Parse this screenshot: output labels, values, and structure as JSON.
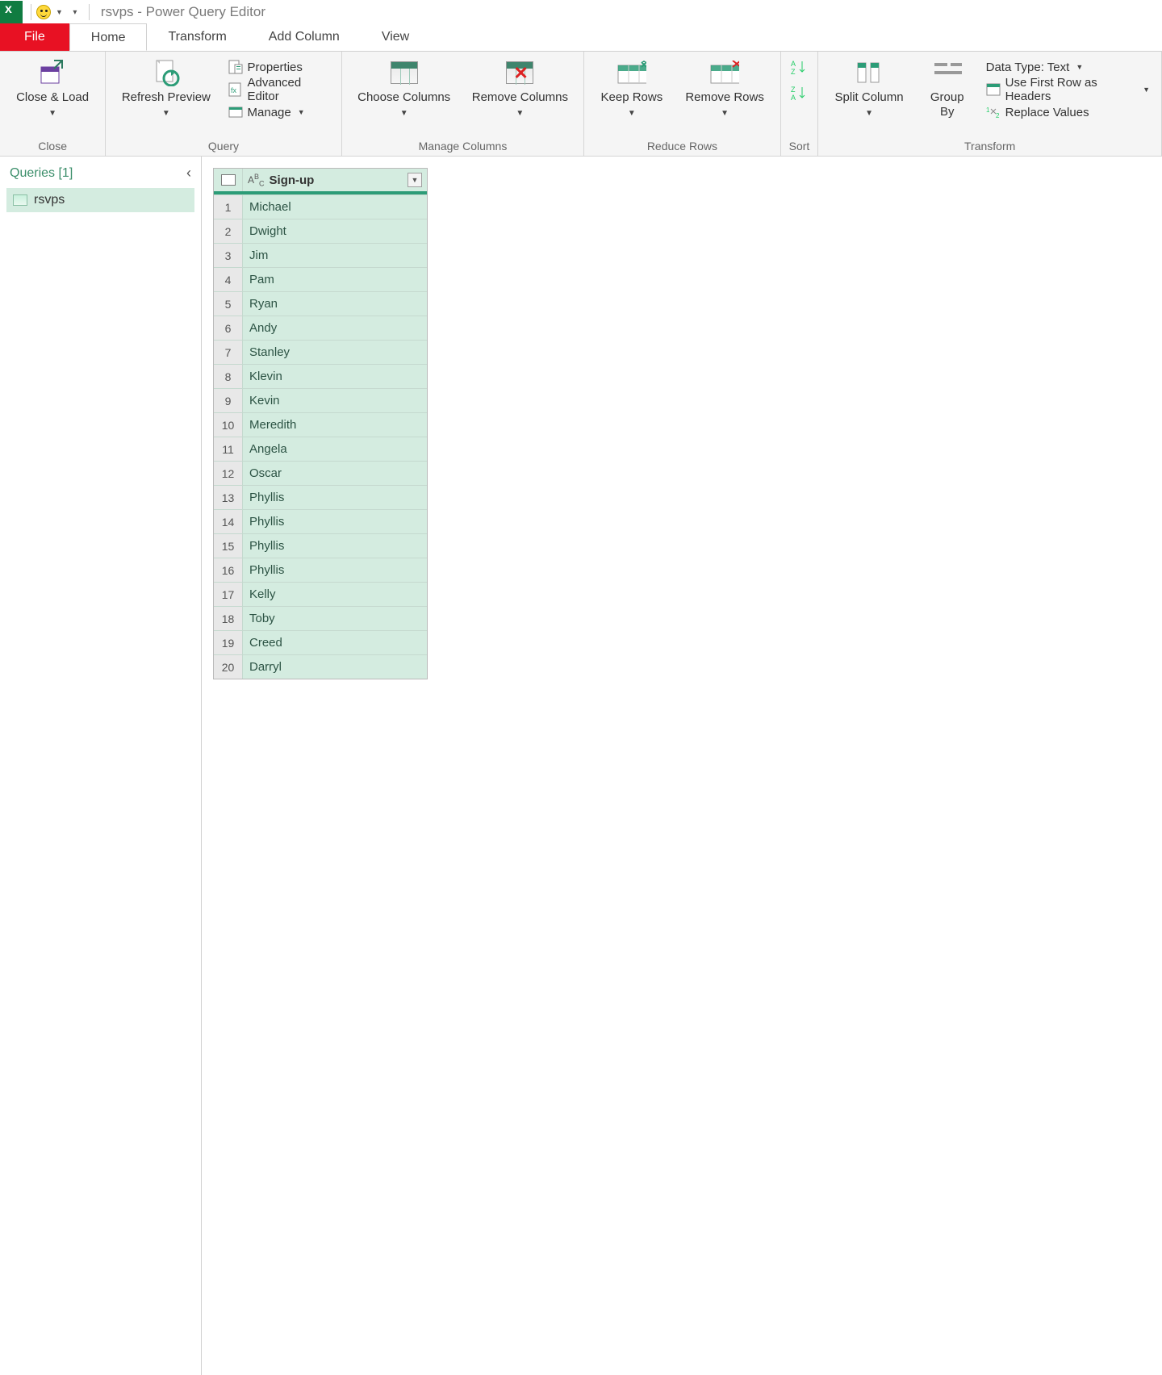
{
  "titlebar": {
    "text": "rsvps - Power Query Editor"
  },
  "tabs": {
    "file": "File",
    "home": "Home",
    "transform": "Transform",
    "addcolumn": "Add Column",
    "view": "View"
  },
  "ribbon": {
    "close_group": "Close",
    "close_load": "Close & Load",
    "query_group": "Query",
    "refresh": "Refresh Preview",
    "properties": "Properties",
    "advanced": "Advanced Editor",
    "manage": "Manage",
    "managecols_group": "Manage Columns",
    "choose_cols": "Choose Columns",
    "remove_cols": "Remove Columns",
    "reduce_group": "Reduce Rows",
    "keep_rows": "Keep Rows",
    "remove_rows": "Remove Rows",
    "sort_group": "Sort",
    "transform_group": "Transform",
    "split_col": "Split Column",
    "group_by": "Group By",
    "data_type": "Data Type: Text",
    "first_row_headers": "Use First Row as Headers",
    "replace_values": "Replace Values"
  },
  "queries": {
    "header": "Queries [1]",
    "items": [
      "rsvps"
    ]
  },
  "table": {
    "column": "Sign-up",
    "rows": [
      "Michael",
      "Dwight",
      "Jim",
      "Pam",
      "Ryan",
      "Andy",
      "Stanley",
      "Klevin",
      "Kevin",
      "Meredith",
      "Angela",
      "Oscar",
      "Phyllis",
      "Phyllis",
      "Phyllis",
      "Phyllis",
      "Kelly",
      "Toby",
      "Creed",
      "Darryl"
    ]
  }
}
